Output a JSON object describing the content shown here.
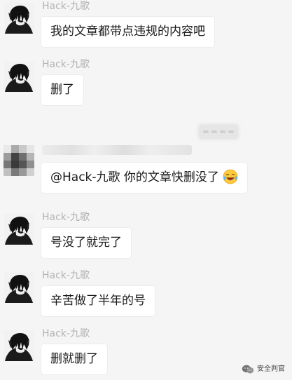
{
  "watermark": {
    "text": "安全判官",
    "icon": "wechat-icon"
  },
  "messages": [
    {
      "sender": "Hack-九歌",
      "text": "我的文章都带点违规的内容吧"
    },
    {
      "sender": "Hack-九歌",
      "text": "删了"
    },
    {
      "sender": "",
      "text": "@Hack-九歌 你的文章快删没了",
      "emoji": "tears-of-joy-emoji"
    },
    {
      "sender": "Hack-九歌",
      "text": "号没了就完了"
    },
    {
      "sender": "Hack-九歌",
      "text": "辛苦做了半年的号"
    },
    {
      "sender": "Hack-九歌",
      "text": "删就删了"
    }
  ]
}
